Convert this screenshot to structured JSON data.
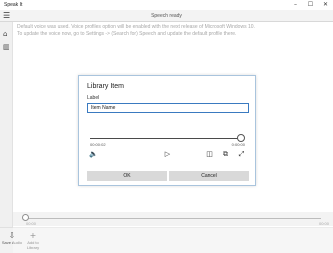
{
  "window": {
    "title": "Speak It",
    "minimize": "–",
    "maximize": "☐",
    "close": "✕"
  },
  "topbar": {
    "status": "Speech ready",
    "menu_icon": "☰"
  },
  "sidebar": {
    "home_icon": "⌂",
    "library_icon": "▥"
  },
  "notice": {
    "line1": "Default voice was used. Voice profiles option will be enabled with the next release of Microsoft Windows 10.",
    "line2": "To update the voice now, go to Settings -> (Search for) Speech and update the default profile there."
  },
  "bottom_player": {
    "time_left": "00:00",
    "time_right": "00:00",
    "progress": 0
  },
  "commandbar": {
    "save_audio": {
      "icon": "⇩",
      "label": "Save Audio"
    },
    "add_to_library": {
      "icon": "+",
      "label_line1": "Add to",
      "label_line2": "Library"
    }
  },
  "dialog": {
    "title": "Library Item",
    "label": "Label",
    "input_value": "Item Name",
    "time_left": "00:00:02",
    "time_right": "0:00:00",
    "progress": 1.0,
    "controls": {
      "volume_icon": "🔈",
      "play_icon": "▷",
      "subtitles_icon": "◫",
      "cast_icon": "⧉",
      "fullscreen_icon": "⤢"
    },
    "ok_label": "OK",
    "cancel_label": "Cancel"
  }
}
